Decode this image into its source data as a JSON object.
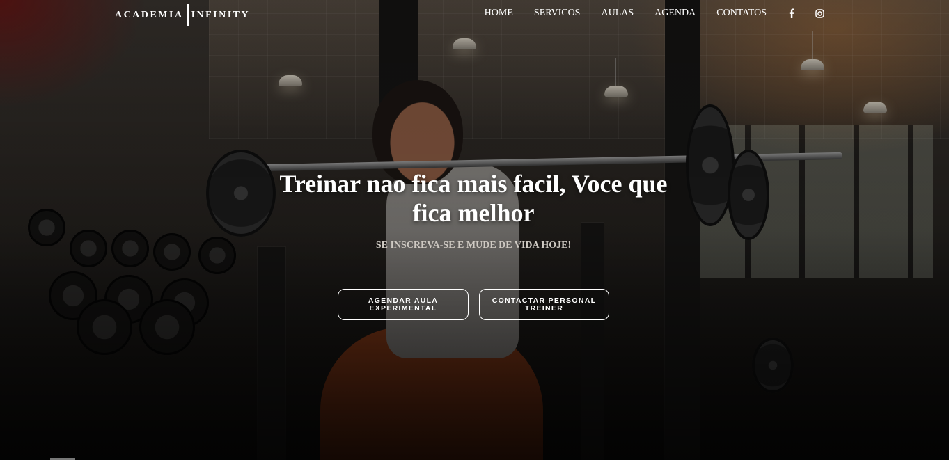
{
  "brand": {
    "part1": "ACADEMIA",
    "part2": "INFINITY"
  },
  "nav": {
    "items": [
      {
        "label": "HOME"
      },
      {
        "label": "SERVICOS"
      },
      {
        "label": "AULAS"
      },
      {
        "label": "AGENDA"
      },
      {
        "label": "CONTATOS"
      }
    ],
    "social": [
      {
        "icon": "facebook-icon"
      },
      {
        "icon": "instagram-icon"
      }
    ]
  },
  "hero": {
    "title": "Treinar nao fica mais facil, Voce que fica melhor",
    "subtitle": "SE INSCREVA-SE E MUDE DE VIDA HOJE!",
    "buttons": [
      {
        "label": "AGENDAR AULA EXPERIMENTAL"
      },
      {
        "label": "CONTACTAR PERSONAL TREINER"
      }
    ]
  },
  "colors": {
    "text": "#ffffff",
    "subtitle": "#cfcac3",
    "accent_warm": "#be6e28"
  }
}
